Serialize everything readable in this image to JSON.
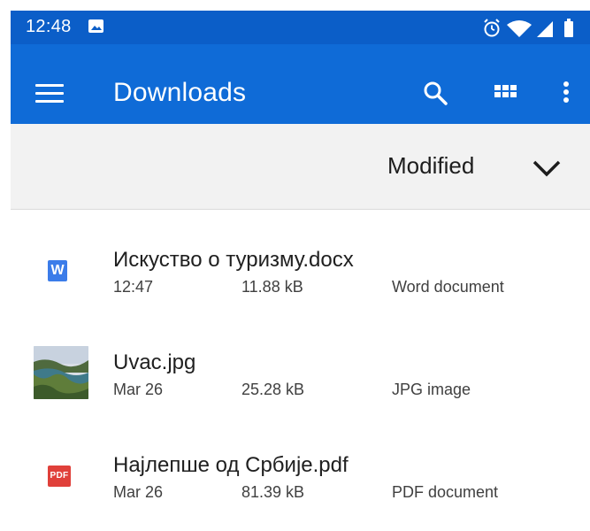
{
  "status_bar": {
    "time": "12:48",
    "icons": [
      "photo-icon",
      "alarm-icon",
      "wifi-icon",
      "signal-icon",
      "battery-icon"
    ]
  },
  "app_bar": {
    "title": "Downloads",
    "actions": [
      "search-icon",
      "grid-view-icon",
      "more-vert-icon"
    ],
    "background": "#0f6bd7"
  },
  "sort": {
    "label": "Modified"
  },
  "files": [
    {
      "name": "Искуство о туризму.docx",
      "date": "12:47",
      "size": "11.88 kB",
      "type": "Word document",
      "icon": "word-icon",
      "icon_letter": "W"
    },
    {
      "name": "Uvac.jpg",
      "date": "Mar 26",
      "size": "25.28 kB",
      "type": "JPG image",
      "icon": "image-thumbnail"
    },
    {
      "name": "Најлепше од Србије.pdf",
      "date": "Mar 26",
      "size": "81.39 kB",
      "type": "PDF document",
      "icon": "pdf-icon",
      "icon_letter": "PDF"
    }
  ]
}
